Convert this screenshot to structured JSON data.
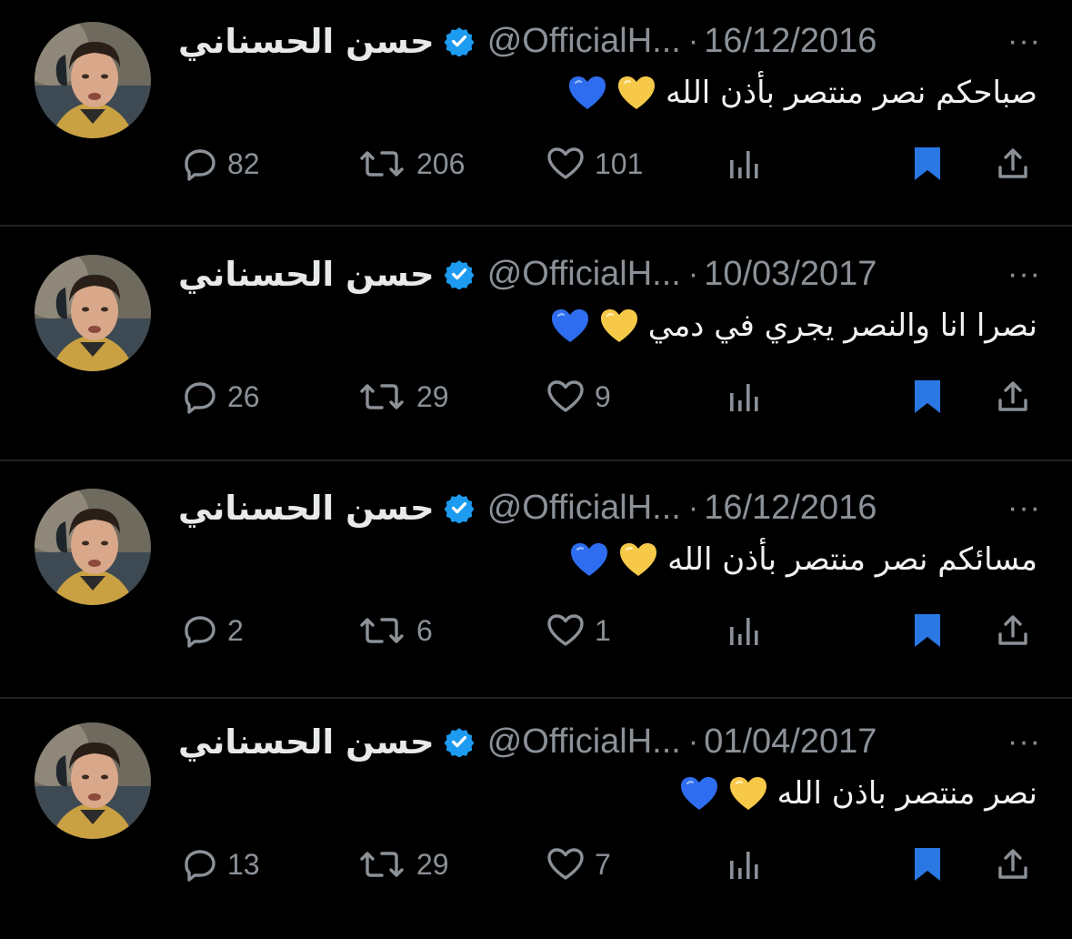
{
  "colors": {
    "background": "#000000",
    "text": "#e7e9ea",
    "muted": "#8b9197",
    "verified": "#1d9bf0",
    "bookmark": "#1d9bf0",
    "heart_yellow": "#f7c948",
    "heart_blue": "#2f6df0"
  },
  "tweets": [
    {
      "name": "حسن الحسناني",
      "handle": "@OfficialH...",
      "separator": "·",
      "date": "16/12/2016",
      "more": "···",
      "text": "صباحكم نصر منتصر بأذن الله",
      "emoji_icons": [
        "yellow-heart",
        "blue-heart"
      ],
      "replies": "82",
      "retweets": "206",
      "likes": "101"
    },
    {
      "name": "حسن الحسناني",
      "handle": "@OfficialH...",
      "separator": "·",
      "date": "10/03/2017",
      "more": "···",
      "text": "نصرا انا والنصر يجري في دمي",
      "emoji_icons": [
        "yellow-heart",
        "blue-heart"
      ],
      "replies": "26",
      "retweets": "29",
      "likes": "9"
    },
    {
      "name": "حسن الحسناني",
      "handle": "@OfficialH...",
      "separator": "·",
      "date": "16/12/2016",
      "more": "···",
      "text": "مسائكم نصر منتصر بأذن الله",
      "emoji_icons": [
        "yellow-heart",
        "blue-heart"
      ],
      "replies": "2",
      "retweets": "6",
      "likes": "1"
    },
    {
      "name": "حسن الحسناني",
      "handle": "@OfficialH...",
      "separator": "·",
      "date": "01/04/2017",
      "more": "···",
      "text": "نصر منتصر باذن الله",
      "emoji_icons": [
        "yellow-heart",
        "blue-heart"
      ],
      "replies": "13",
      "retweets": "29",
      "likes": "7"
    }
  ]
}
